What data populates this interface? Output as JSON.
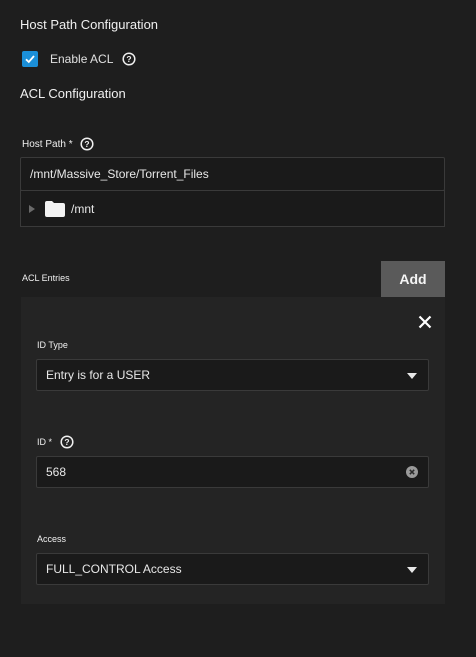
{
  "host_path_config": {
    "title": "Host Path Configuration",
    "enable_acl_label": "Enable ACL",
    "enable_acl_checked": true
  },
  "acl_config": {
    "title": "ACL Configuration",
    "host_path_label": "Host Path *",
    "host_path_value": "/mnt/Massive_Store/Torrent_Files",
    "tree_root": "/mnt"
  },
  "acl_entries": {
    "title": "ACL Entries",
    "add_label": "Add",
    "entry": {
      "id_type_label": "ID Type",
      "id_type_value": "Entry is for a USER",
      "id_label": "ID *",
      "id_value": "568",
      "access_label": "Access",
      "access_value": "FULL_CONTROL Access"
    }
  },
  "icons": {
    "help": "help-circle-icon",
    "check": "check-icon",
    "folder": "folder-icon",
    "expand": "triangle-right-icon",
    "close": "close-icon",
    "dropdown": "caret-down-icon",
    "clear": "clear-circle-icon"
  },
  "colors": {
    "background": "#1e1e1e",
    "card": "#242424",
    "accent": "#1b8fd8",
    "button": "#5a5a5a"
  }
}
